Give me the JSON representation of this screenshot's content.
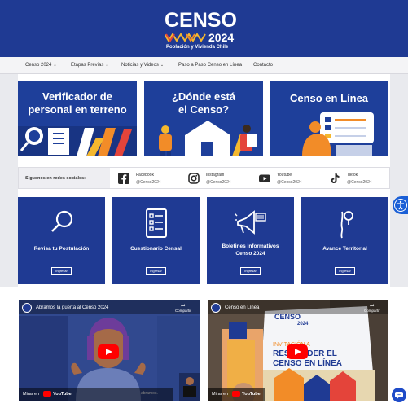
{
  "header": {
    "logo_title": "CENSO",
    "logo_year": "2024",
    "logo_subtitle": "Población y Vivienda Chile",
    "brand_color": "#1f3a93"
  },
  "nav": {
    "items": [
      {
        "label": "Censo 2024",
        "has_dropdown": true
      },
      {
        "label": "Etapas Previas",
        "has_dropdown": true
      },
      {
        "label": "Noticias y Videos",
        "has_dropdown": true
      },
      {
        "label": "Paso a Paso Censo en Línea",
        "has_dropdown": false
      },
      {
        "label": "Contacto",
        "has_dropdown": false
      }
    ],
    "chevron": "⌄"
  },
  "banners": [
    {
      "line1": "Verificador de",
      "line2": "personal en terreno",
      "icon": "magnifier-document-icon"
    },
    {
      "line1": "¿Dónde está",
      "line2": "el Censo?",
      "icon": "house-people-icon"
    },
    {
      "line1": "Censo en Línea",
      "line2": "",
      "icon": "person-laptop-icon"
    }
  ],
  "social": {
    "label": "Síguenos en redes sociales:",
    "items": [
      {
        "name": "Facebook",
        "handle": "@Censo2024",
        "icon": "facebook-icon"
      },
      {
        "name": "Instagram",
        "handle": "@Censo2024",
        "icon": "instagram-icon"
      },
      {
        "name": "Youtube",
        "handle": "@Censo2024",
        "icon": "youtube-icon"
      },
      {
        "name": "Tiktok",
        "handle": "@Censo2024",
        "icon": "tiktok-icon"
      }
    ]
  },
  "cards": [
    {
      "title_line1": "Revisa tu Postulación",
      "title_line2": "",
      "button": "Ingresar",
      "icon": "search-icon"
    },
    {
      "title_line1": "Cuestionario Censal",
      "title_line2": "",
      "button": "Ingresar",
      "icon": "checklist-icon"
    },
    {
      "title_line1": "Boletines Informativos",
      "title_line2": "Censo 2024",
      "button": "Ingresar",
      "icon": "megaphone-icon"
    },
    {
      "title_line1": "Avance Territorial",
      "title_line2": "",
      "button": "Ingresar",
      "icon": "map-pin-icon"
    }
  ],
  "videos": [
    {
      "title": "Abramos la puerta al Censo 2024",
      "share": "Compartir",
      "watch_on": "Mirar en",
      "platform": "YouTube",
      "caption": "abramos."
    },
    {
      "title": "Censo en Línea",
      "share": "Compartir",
      "watch_on": "Mirar en",
      "platform": "YouTube",
      "caption": ""
    }
  ],
  "video2_poster": {
    "logo_title": "CENSO",
    "logo_year": "2024",
    "line1": "INVITACIÓN A",
    "line2": "RESPONDER EL",
    "line3": "CENSO EN LÍNEA"
  },
  "colors": {
    "accent_orange": "#f28c28",
    "accent_yellow": "#f5b82e",
    "accent_red": "#e4443a",
    "youtube_red": "#ff0000"
  }
}
